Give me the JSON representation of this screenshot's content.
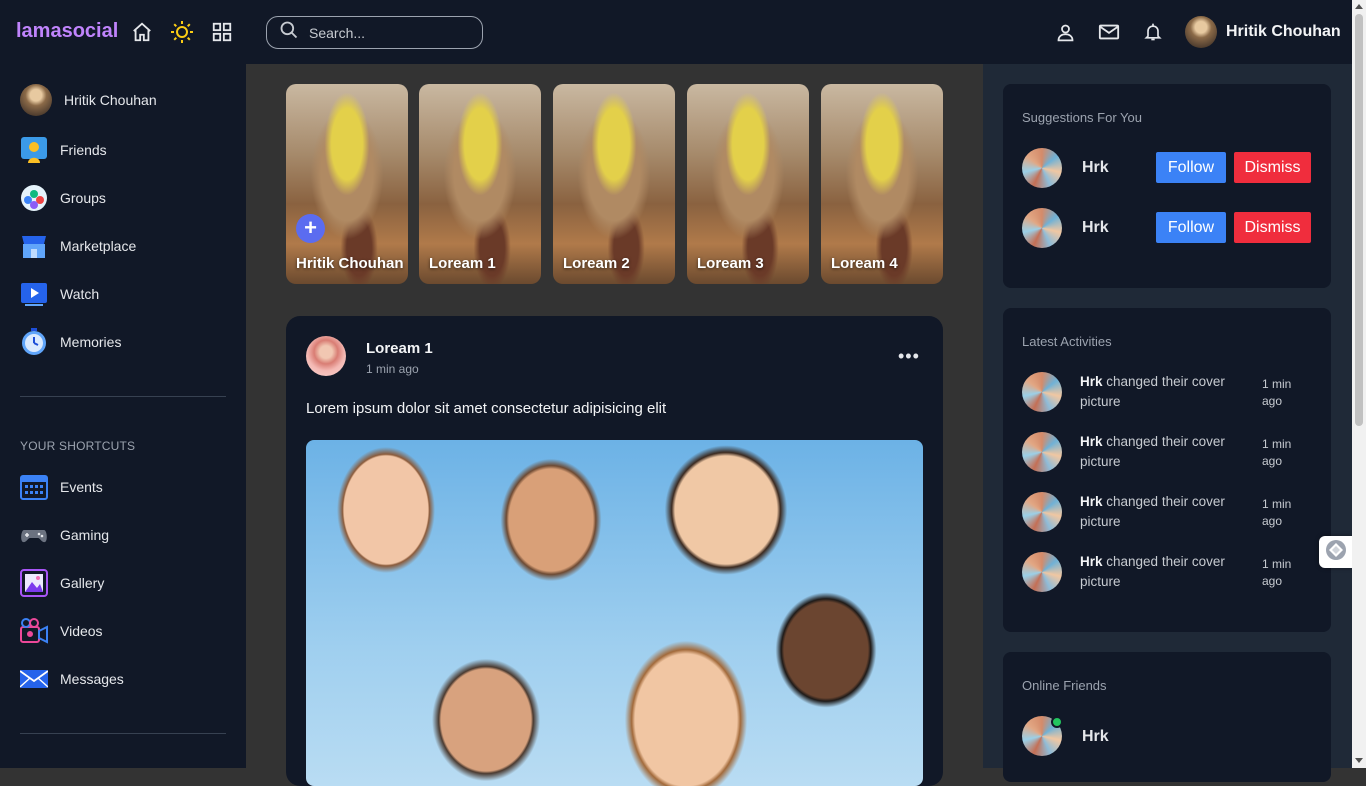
{
  "navbar": {
    "logo": "lamasocial",
    "search_placeholder": "Search...",
    "user_name": "Hritik Chouhan",
    "icons": [
      "home-icon",
      "sun-icon",
      "grid-icon",
      "user-icon",
      "mail-icon",
      "bell-icon"
    ]
  },
  "sidebar": {
    "user_name": "Hritik Chouhan",
    "menu": [
      {
        "label": "Friends",
        "icon": "friends-icon"
      },
      {
        "label": "Groups",
        "icon": "groups-icon"
      },
      {
        "label": "Marketplace",
        "icon": "marketplace-icon"
      },
      {
        "label": "Watch",
        "icon": "watch-icon"
      },
      {
        "label": "Memories",
        "icon": "memories-icon"
      }
    ],
    "shortcuts_heading": "YOUR SHORTCUTS",
    "shortcuts": [
      {
        "label": "Events",
        "icon": "events-icon"
      },
      {
        "label": "Gaming",
        "icon": "gaming-icon"
      },
      {
        "label": "Gallery",
        "icon": "gallery-icon"
      },
      {
        "label": "Videos",
        "icon": "videos-icon"
      },
      {
        "label": "Messages",
        "icon": "messages-icon"
      }
    ]
  },
  "stories": [
    {
      "name": "Hritik Chouhan",
      "add": "+"
    },
    {
      "name": "Loream 1"
    },
    {
      "name": "Loream 2"
    },
    {
      "name": "Loream 3"
    },
    {
      "name": "Loream 4"
    }
  ],
  "post": {
    "author": "Loream 1",
    "time": "1 min ago",
    "more": "•••",
    "text": "Lorem ipsum dolor sit amet consectetur adipisicing elit"
  },
  "suggestions": {
    "title": "Suggestions For You",
    "items": [
      {
        "name": "Hrk",
        "follow": "Follow",
        "dismiss": "Dismiss"
      },
      {
        "name": "Hrk",
        "follow": "Follow",
        "dismiss": "Dismiss"
      }
    ]
  },
  "activities": {
    "title": "Latest Activities",
    "items": [
      {
        "name": "Hrk",
        "text": " changed their cover picture",
        "time": "1 min ago"
      },
      {
        "name": "Hrk",
        "text": " changed their cover picture",
        "time": "1 min ago"
      },
      {
        "name": "Hrk",
        "text": " changed their cover picture",
        "time": "1 min ago"
      },
      {
        "name": "Hrk",
        "text": " changed their cover picture",
        "time": "1 min ago"
      }
    ]
  },
  "online": {
    "title": "Online Friends",
    "items": [
      {
        "name": "Hrk",
        "status": "online"
      }
    ]
  },
  "colors": {
    "navbar_bg": "#111827",
    "logo": "#c084fc",
    "follow": "#3b82f6",
    "dismiss": "#f02d3d",
    "online": "#22c55e"
  }
}
